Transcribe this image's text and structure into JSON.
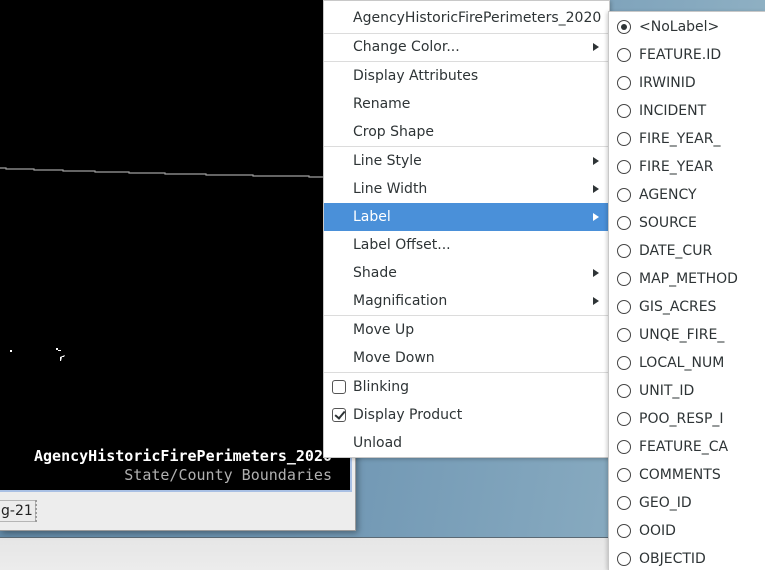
{
  "map": {
    "legend": [
      "AgencyHistoricFirePerimeters_2020",
      "State/County Boundaries"
    ],
    "colors": {
      "background": "#000000",
      "boundary_line": "#a0a0a0",
      "legend_primary": "#ffffff",
      "legend_secondary": "#b0b0b0"
    }
  },
  "status_bar": {
    "field_text": "g-21"
  },
  "context_menu": {
    "title_item": "AgencyHistoricFirePerimeters_2020",
    "items": [
      {
        "label": "AgencyHistoricFirePerimeters_2020",
        "submenu": false
      },
      {
        "label": "Change Color...",
        "submenu": true
      },
      {
        "label": "Display Attributes",
        "submenu": false
      },
      {
        "label": "Rename",
        "submenu": false
      },
      {
        "label": "Crop Shape",
        "submenu": false
      },
      {
        "label": "Line Style",
        "submenu": true
      },
      {
        "label": "Line Width",
        "submenu": true
      },
      {
        "label": "Label",
        "submenu": true,
        "highlighted": true
      },
      {
        "label": "Label Offset...",
        "submenu": false
      },
      {
        "label": "Shade",
        "submenu": true
      },
      {
        "label": "Magnification",
        "submenu": true
      },
      {
        "label": "Move Up",
        "submenu": false
      },
      {
        "label": "Move Down",
        "submenu": false
      },
      {
        "label": "Blinking",
        "checkbox": true,
        "checked": false
      },
      {
        "label": "Display Product",
        "checkbox": true,
        "checked": true
      },
      {
        "label": "Unload",
        "submenu": false
      }
    ],
    "highlight_color": "#4a90d9"
  },
  "label_submenu": {
    "selected": "<NoLabel>",
    "options": [
      "<NoLabel>",
      "FEATURE.ID",
      "IRWINID",
      "INCIDENT",
      "FIRE_YEAR_",
      "FIRE_YEAR",
      "AGENCY",
      "SOURCE",
      "DATE_CUR",
      "MAP_METHOD",
      "GIS_ACRES",
      "UNQE_FIRE_",
      "LOCAL_NUM",
      "UNIT_ID",
      "POO_RESP_I",
      "FEATURE_CA",
      "COMMENTS",
      "GEO_ID",
      "OOID",
      "OBJECTID"
    ]
  }
}
